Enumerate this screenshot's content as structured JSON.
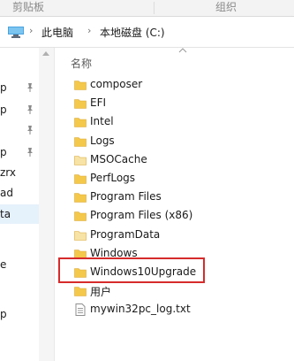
{
  "ribbon": {
    "group_left": "剪贴板",
    "group_right": "组织"
  },
  "address_bar": {
    "crumbs": [
      "此电脑",
      "本地磁盘 (C:)"
    ]
  },
  "nav_pane": {
    "rows": [
      "p",
      "p",
      "",
      "p",
      "zrx",
      "ad",
      "ta",
      "",
      "e",
      "",
      "p"
    ]
  },
  "content": {
    "column_header": "名称",
    "items": [
      {
        "name": "composer",
        "type": "folder"
      },
      {
        "name": "EFI",
        "type": "folder"
      },
      {
        "name": "Intel",
        "type": "folder"
      },
      {
        "name": "Logs",
        "type": "folder"
      },
      {
        "name": "MSOCache",
        "type": "folder-hidden"
      },
      {
        "name": "PerfLogs",
        "type": "folder"
      },
      {
        "name": "Program Files",
        "type": "folder"
      },
      {
        "name": "Program Files (x86)",
        "type": "folder"
      },
      {
        "name": "ProgramData",
        "type": "folder-hidden"
      },
      {
        "name": "Windows",
        "type": "folder"
      },
      {
        "name": "Windows10Upgrade",
        "type": "folder"
      },
      {
        "name": "用户",
        "type": "folder"
      },
      {
        "name": "mywin32pc_log.txt",
        "type": "text-file"
      }
    ]
  },
  "annotation": {
    "highlighted_item": "Windows10Upgrade",
    "highlight_color": "#d62b2b"
  },
  "colors": {
    "folder": "#f4c84a",
    "folder_hidden": "#f7e3a6",
    "selection": "#e5f1fb"
  }
}
